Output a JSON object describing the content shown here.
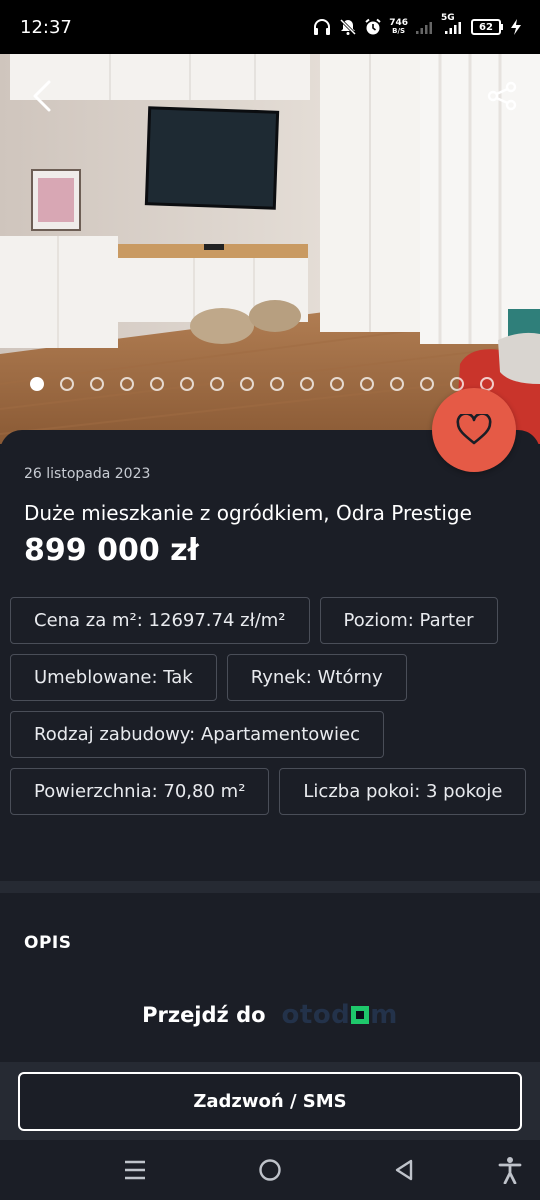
{
  "status_bar": {
    "time": "12:37",
    "net_speed_value": "746",
    "net_speed_unit": "B/S",
    "network_type": "5G",
    "battery": "62",
    "icons": [
      "headphones-icon",
      "mute-icon",
      "alarm-icon",
      "signal-icon",
      "signal-icon",
      "battery-icon",
      "charging-icon"
    ]
  },
  "gallery": {
    "image_count": 16,
    "active_index": 0
  },
  "listing": {
    "date": "26 listopada 2023",
    "title": "Duże mieszkanie z ogródkiem, Odra Prestige",
    "price": "899 000 zł",
    "attributes": [
      "Cena za m²: 12697.74 zł/m²",
      "Poziom: Parter",
      "Umeblowane: Tak",
      "Rynek: Wtórny",
      "Rodzaj zabudowy: Apartamentowiec",
      "Powierzchnia: 70,80 m²",
      "Liczba pokoi: 3 pokoje"
    ]
  },
  "description": {
    "section_title": "OPIS",
    "link_label": "Przejdź do",
    "logo_text_before": "otod",
    "logo_text_after": "m"
  },
  "actions": {
    "call_label": "Zadzwoń / SMS"
  },
  "colors": {
    "background": "#1b1e26",
    "favorite": "#e55a46",
    "logo_accent": "#1ec86b"
  }
}
